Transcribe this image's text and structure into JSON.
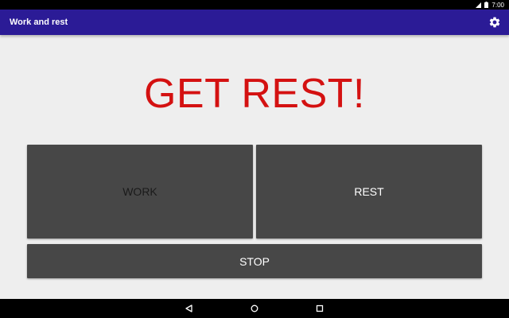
{
  "status_bar": {
    "time": "7:00",
    "icons": [
      "signal-icon",
      "battery-icon"
    ]
  },
  "app_bar": {
    "title": "Work and rest",
    "settings_icon": "gear-icon"
  },
  "main": {
    "message": "GET REST!",
    "message_color": "#d41111",
    "buttons": {
      "work": "WORK",
      "rest": "REST",
      "stop": "STOP"
    }
  },
  "nav_bar": {
    "icons": [
      "back-icon",
      "home-icon",
      "recents-icon"
    ]
  },
  "colors": {
    "app_bar": "#2b1b96",
    "background": "#eeeeee",
    "button": "#474747",
    "work_label": "#1a1a1a",
    "active_label": "#ffffff"
  }
}
